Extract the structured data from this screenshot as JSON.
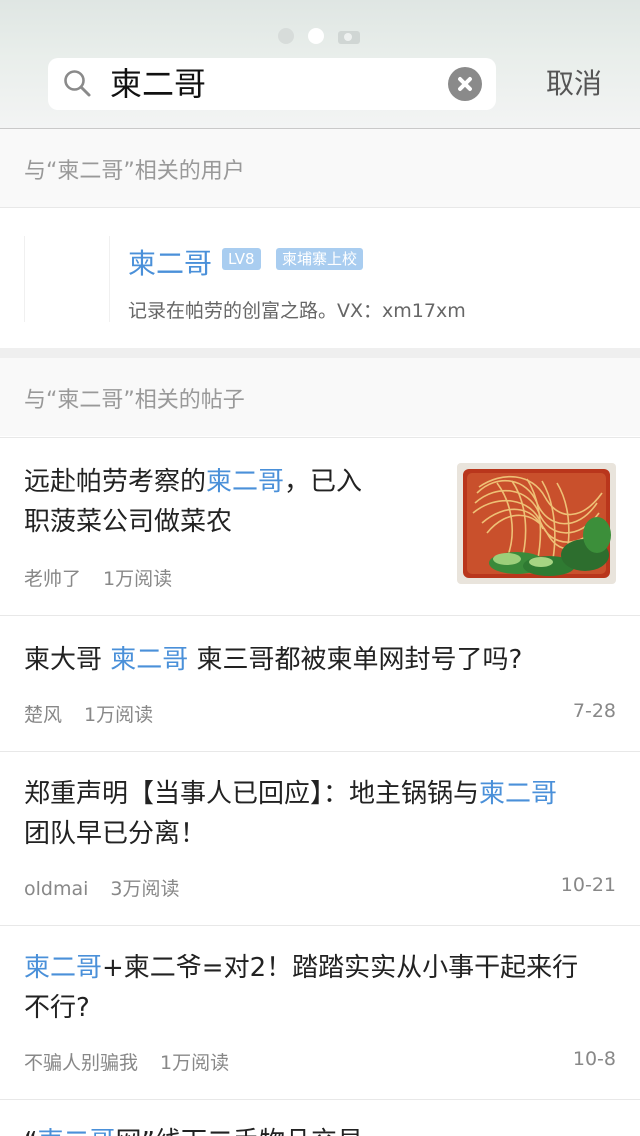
{
  "search": {
    "query": "柬二哥",
    "cancel_label": "取消"
  },
  "users_section": {
    "header": "与“柬二哥”相关的用户",
    "user": {
      "name": "柬二哥",
      "level_badge": "LV8",
      "title_badge": "柬埔寨上校",
      "description": "记录在帕劳的创富之路。VX：xm17xm"
    }
  },
  "posts_section": {
    "header": "与“柬二哥”相关的帖子",
    "posts": [
      {
        "title_before": "远赴帕劳考察的",
        "title_highlight": "柬二哥",
        "title_after": "，已入",
        "title_line2": "职菠菜公司做菜农",
        "author": "老帅了",
        "reads": "1万阅读",
        "date": "",
        "thumbnail": "noodles-with-greens-image"
      },
      {
        "title_before": "柬大哥 ",
        "title_highlight": "柬二哥",
        "title_after": " 柬三哥都被柬单网封号了吗?",
        "title_line2": "",
        "author": "楚风",
        "reads": "1万阅读",
        "date": "7-28"
      },
      {
        "title_before": "郑重声明【当事人已回应】：地主锅锅与",
        "title_highlight": "柬二哥",
        "title_after": "",
        "title_line2": "团队早已分离！",
        "author": "oldmai",
        "reads": "3万阅读",
        "date": "10-21"
      },
      {
        "title_before": "",
        "title_highlight": "柬二哥",
        "title_after": "+柬二爷=对2！踏踏实实从小事干起来行",
        "title_line2": "不行?",
        "author": "不骗人别骗我",
        "reads": "1万阅读",
        "date": "10-8"
      },
      {
        "title_before": "“",
        "title_highlight": "柬二哥",
        "title_after": "网”线下二手物品交易",
        "title_line2": "",
        "author": "",
        "reads": "",
        "date": ""
      }
    ]
  },
  "colors": {
    "accent": "#4a90d9",
    "badge": "#a9cdf0",
    "section_bg": "#f9f9f9",
    "meta_text": "#888888"
  }
}
